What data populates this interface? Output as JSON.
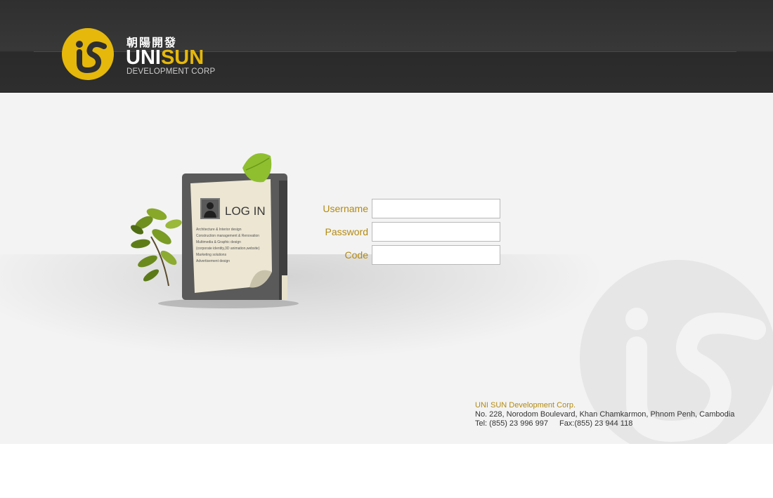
{
  "header": {
    "logo": {
      "cjk_name": "朝陽開發",
      "brand_uni": "UNI",
      "brand_sun": "SUN",
      "subtitle": "DEVELOPMENT CORP"
    }
  },
  "illustration": {
    "title": "LOG IN",
    "services": [
      "Architecture & Interior design",
      "Construction management & Renovation",
      "Multimedia & Graphic design",
      "(corporate identity,3D animation,website)",
      "Marketing solutions",
      "Advertisement design"
    ]
  },
  "login_form": {
    "username_label": "Username",
    "username_value": "",
    "password_label": "Password",
    "password_value": "",
    "code_label": "Code",
    "code_value": ""
  },
  "footer": {
    "company": "UNI SUN Development Corp.",
    "address": "No. 228, Norodom Boulevard, Khan Chamkarmon, Phnom Penh, Cambodia",
    "tel": "Tel: (855) 23 996 997",
    "fax": "Fax:(855) 23 944 118"
  },
  "colors": {
    "accent_gold": "#e5b80b",
    "label_gold": "#b38a10",
    "header_dark": "#2f2f2f",
    "body_bg": "#f3f3f3"
  },
  "icons": [
    "unisun-logo-icon",
    "user-silhouette-icon",
    "leaf-icon",
    "plant-icon",
    "watermark-logo-icon"
  ]
}
